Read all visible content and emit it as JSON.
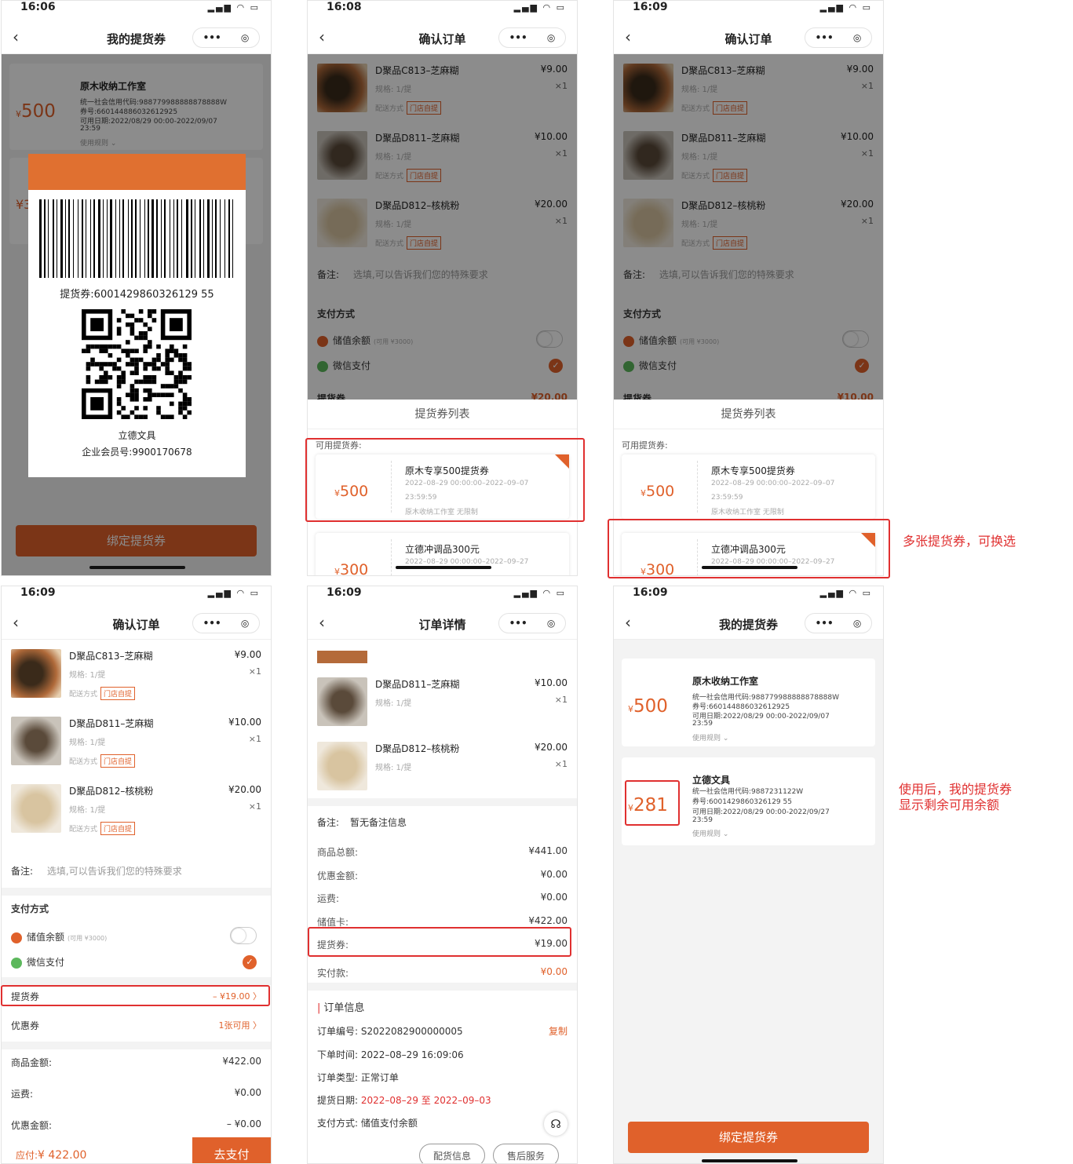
{
  "status": {
    "p1": "16:06",
    "p2": "16:08",
    "p3": "16:09",
    "p4": "16:09",
    "p5": "16:09",
    "p6": "16:09",
    "icons": "▂▄▆ ◠ ▭"
  },
  "nav": {
    "my_vouchers": "我的提货券",
    "confirm_order": "确认订单",
    "order_detail": "订单详情",
    "more": "•••",
    "target": "◎"
  },
  "currency": "¥",
  "voucher_a": {
    "amount": "500",
    "shop": "原木收纳工作室",
    "credit": "统一社会信用代码:988779988888878888W",
    "code": "券号:660144886032612925",
    "valid": "可用日期:2022/08/29 00:00-2022/09/07",
    "time": "23:59",
    "rules": "使用规则 ⌄"
  },
  "voucher_b": {
    "amount": "281",
    "shop": "立德文具",
    "credit": "统一社会信用代码:9887231122W",
    "code": "券号:6001429860326129 55",
    "valid": "可用日期:2022/08/29 00:00-2022/09/27",
    "time": "23:59",
    "rules": "使用规则 ⌄"
  },
  "barcode_popup": {
    "code_label": "提货券:6001429860326129 55",
    "company": "立德文具",
    "member": "企业会员号:9900170678",
    "partial_amt": "¥3"
  },
  "bind_btn": "绑定提货券",
  "products": [
    {
      "name": "D聚品C813–芝麻糊",
      "spec": "规格: 1/提",
      "delivery": "配送方式",
      "tag": "门店自提",
      "price": "¥9.00",
      "qty": "×1"
    },
    {
      "name": "D聚品D811–芝麻糊",
      "spec": "规格: 1/提",
      "delivery": "配送方式",
      "tag": "门店自提",
      "price": "¥10.00",
      "qty": "×1"
    },
    {
      "name": "D聚品D812–核桃粉",
      "spec": "规格: 1/提",
      "delivery": "配送方式",
      "tag": "门店自提",
      "price": "¥20.00",
      "qty": "×1"
    }
  ],
  "remark": {
    "label": "备注:",
    "placeholder": "选填,可以告诉我们您的特殊要求",
    "empty": "暂无备注信息"
  },
  "payment": {
    "title": "支付方式",
    "balance": "储值余额",
    "balance_hint": "(可用 ¥3000)",
    "wechat": "微信支付"
  },
  "sheet": {
    "title": "提货券列表",
    "available": "可用提货券:",
    "peek_label": "提货券",
    "peek_amt": "¥20.00",
    "peek_amt3": "¥10.00"
  },
  "voucher_list": [
    {
      "amount": "500",
      "name": "原木专享500提货券",
      "d1": "2022–08–29 00:00:00–2022–09–07",
      "d2": "23:59:59",
      "d3": "原木收纳工作室 无限制"
    },
    {
      "amount": "300",
      "name": "立德冲调品300元",
      "d1": "2022–08–29 00:00:00–2022–09–27"
    }
  ],
  "confirm": {
    "voucher_label": "提货券",
    "voucher_val": "– ¥19.00 〉",
    "coupon_label": "优惠券",
    "coupon_val": "1张可用 〉",
    "goods_label": "商品金额:",
    "goods_val": "¥422.00",
    "ship_label": "运费:",
    "ship_val": "¥0.00",
    "disc_label": "优惠金额:",
    "disc_val": "– ¥0.00",
    "pay_label": "应付:",
    "pay_val": "¥ 422.00",
    "pay_btn": "去支付"
  },
  "detail": {
    "rows": [
      {
        "l": "商品总额:",
        "v": "¥441.00"
      },
      {
        "l": "优惠金额:",
        "v": "¥0.00"
      },
      {
        "l": "运费:",
        "v": "¥0.00"
      },
      {
        "l": "储值卡:",
        "v": "¥422.00"
      },
      {
        "l": "提货券:",
        "v": "¥19.00"
      },
      {
        "l": "实付款:",
        "v": "¥0.00"
      }
    ],
    "info_title": "订单信息",
    "order_no_l": "订单编号:",
    "order_no": "S2022082900000005",
    "copy": "复制",
    "time_l": "下单时间:",
    "time": "2022–08–29 16:09:06",
    "type_l": "订单类型:",
    "type": "正常订单",
    "pick_l": "提货日期:",
    "pick": "2022–08–29 至 2022–09–03",
    "pay_l": "支付方式:",
    "pay": "储值支付余额",
    "btn1": "配货信息",
    "btn2": "售后服务"
  },
  "notes": {
    "n1": "多张提货券，可换选",
    "n2a": "使用后，我的提货券",
    "n2b": "显示剩余可用余额"
  }
}
